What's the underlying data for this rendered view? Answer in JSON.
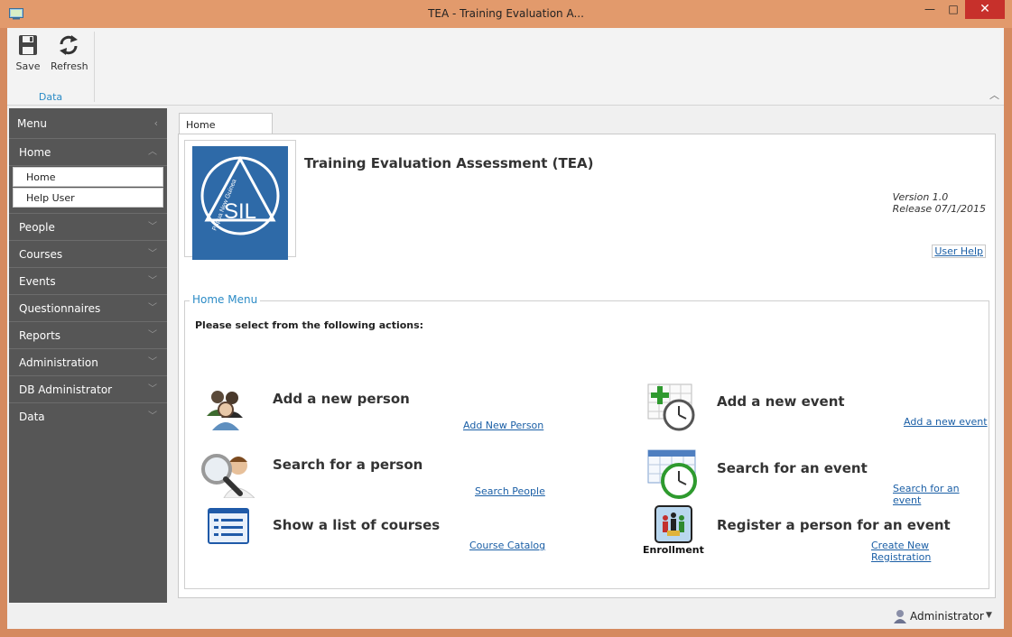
{
  "window": {
    "title": "TEA - Training Evaluation A...",
    "minimize": "—",
    "maximize": "□",
    "close": "✕"
  },
  "ribbon": {
    "buttons": [
      {
        "label": "Save",
        "icon": "save-icon"
      },
      {
        "label": "Refresh",
        "icon": "refresh-icon"
      }
    ],
    "group_label": "Data"
  },
  "sidebar": {
    "title": "Menu",
    "groups": [
      {
        "label": "Home",
        "expanded": true,
        "items": [
          "Home",
          "Help User"
        ]
      },
      {
        "label": "People"
      },
      {
        "label": "Courses"
      },
      {
        "label": "Events"
      },
      {
        "label": "Questionnaires"
      },
      {
        "label": "Reports"
      },
      {
        "label": "Administration"
      },
      {
        "label": "DB Administrator"
      },
      {
        "label": "Data"
      }
    ]
  },
  "tab": {
    "label": "Home"
  },
  "header": {
    "title": "Training Evaluation Assessment (TEA)",
    "version": "Version 1.0",
    "release": "Release 07/1/2015",
    "user_help": "User Help",
    "logo_text": "SIL",
    "logo_arc_text": "Papua New Guinea"
  },
  "home_menu": {
    "legend": "Home Menu",
    "prompt": "Please select from the following actions:",
    "actions": [
      {
        "title": "Add a new person",
        "link": "Add New Person",
        "icon": "people-icon"
      },
      {
        "title": "Search for a person",
        "link": "Search People",
        "icon": "magnifier-person-icon"
      },
      {
        "title": "Show a list of courses",
        "link": "Course Catalog",
        "icon": "list-icon"
      },
      {
        "title": "Add a new event",
        "link": "Add a new event",
        "icon": "calendar-add-icon"
      },
      {
        "title": "Search for an event",
        "link": "Search for an event",
        "icon": "calendar-clock-icon"
      },
      {
        "title": "Register a person for an event",
        "link": "Create New Registration",
        "icon": "enrollment-icon",
        "icon_caption": "Enrollment"
      }
    ]
  },
  "status": {
    "user": "Administrator"
  },
  "colors": {
    "accent": "#2b8bc6",
    "titlebar": "#e29a6c",
    "sidebar": "#565656",
    "close": "#c7302b",
    "link": "#1b5fa6"
  }
}
